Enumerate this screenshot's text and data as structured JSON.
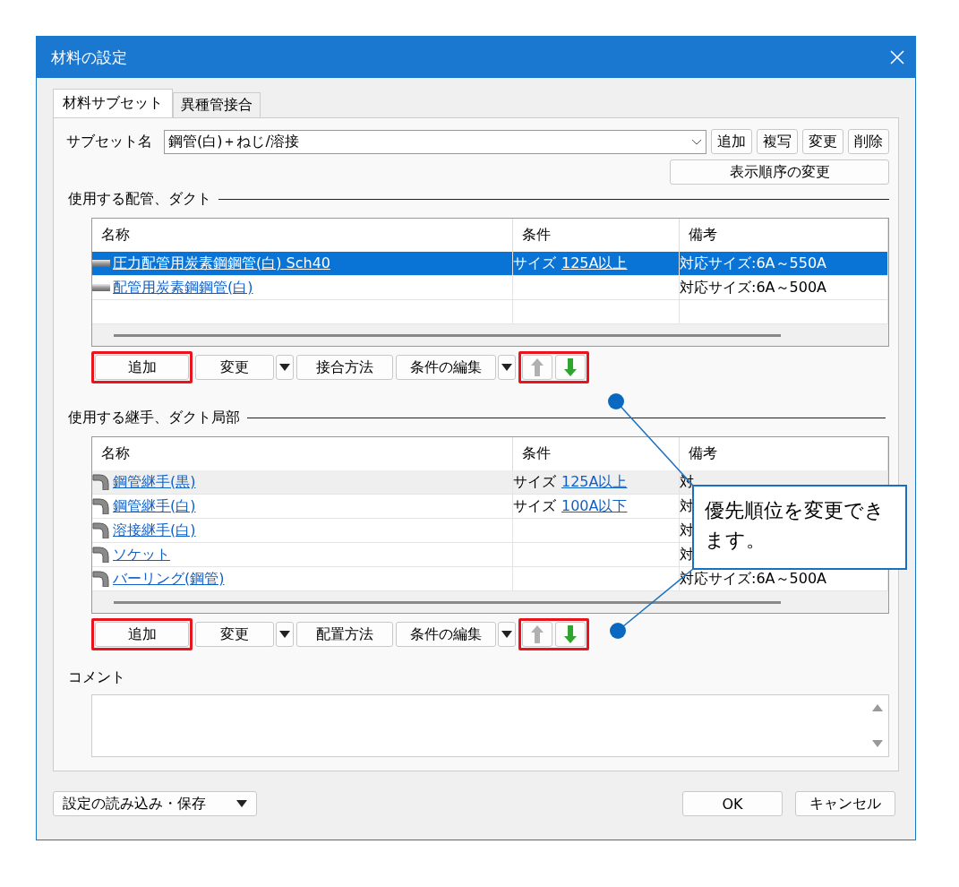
{
  "window": {
    "title": "材料の設定"
  },
  "tabs": [
    {
      "label": "材料サブセット",
      "selected": true
    },
    {
      "label": "異種管接合",
      "selected": false
    }
  ],
  "subset": {
    "label": "サブセット名",
    "value": "鋼管(白)＋ねじ/溶接",
    "buttons": [
      "追加",
      "複写",
      "変更",
      "削除"
    ],
    "order_button": "表示順序の変更"
  },
  "pipes": {
    "heading": "使用する配管、ダクト",
    "columns": [
      "名称",
      "条件",
      "備考"
    ],
    "rows": [
      {
        "name": "圧力配管用炭素鋼鋼管(白) Sch40",
        "condition_label": "サイズ",
        "condition_value": "125A以上",
        "remark": "対応サイズ:6A～550A",
        "selected": true,
        "hovered": false
      },
      {
        "name": "配管用炭素鋼鋼管(白)",
        "remark": "対応サイズ:6A～500A",
        "selected": false,
        "hovered": false
      }
    ],
    "buttons": [
      {
        "kind": "button",
        "label": "追加",
        "highlighted": true
      },
      {
        "kind": "split",
        "label": "変更",
        "highlighted": false
      },
      {
        "kind": "button",
        "label": "接合方法",
        "highlighted": false
      },
      {
        "kind": "split",
        "label": "条件の編集",
        "highlighted": false
      },
      {
        "kind": "arrows",
        "up_enabled": false,
        "down_enabled": true,
        "highlighted": true
      }
    ]
  },
  "joints": {
    "heading": "使用する継手、ダクト局部",
    "columns": [
      "名称",
      "条件",
      "備考"
    ],
    "rows": [
      {
        "name": "鋼管継手(黒)",
        "condition_label": "サイズ",
        "condition_value": "125A以上",
        "remark": "対",
        "selected": false,
        "hovered": true
      },
      {
        "name": "鋼管継手(白)",
        "condition_label": "サイズ",
        "condition_value": "100A以下",
        "remark": "対",
        "selected": false,
        "hovered": false
      },
      {
        "name": "溶接継手(白)",
        "remark": "対",
        "selected": false,
        "hovered": false
      },
      {
        "name": "ソケット",
        "remark": "対",
        "selected": false,
        "hovered": false
      },
      {
        "name": "バーリング(鋼管)",
        "remark": "対応サイズ:6A～500A",
        "selected": false,
        "hovered": false
      }
    ],
    "buttons": [
      {
        "kind": "button",
        "label": "追加",
        "highlighted": true
      },
      {
        "kind": "split",
        "label": "変更",
        "highlighted": false
      },
      {
        "kind": "button",
        "label": "配置方法",
        "highlighted": false
      },
      {
        "kind": "split",
        "label": "条件の編集",
        "highlighted": false
      },
      {
        "kind": "arrows",
        "up_enabled": false,
        "down_enabled": true,
        "highlighted": true
      }
    ]
  },
  "comment": {
    "label": "コメント"
  },
  "footer": {
    "menu_button": "設定の読み込み・保存",
    "ok": "OK",
    "cancel": "キャンセル"
  },
  "callout": {
    "text": "優先順位を変更できます。"
  }
}
